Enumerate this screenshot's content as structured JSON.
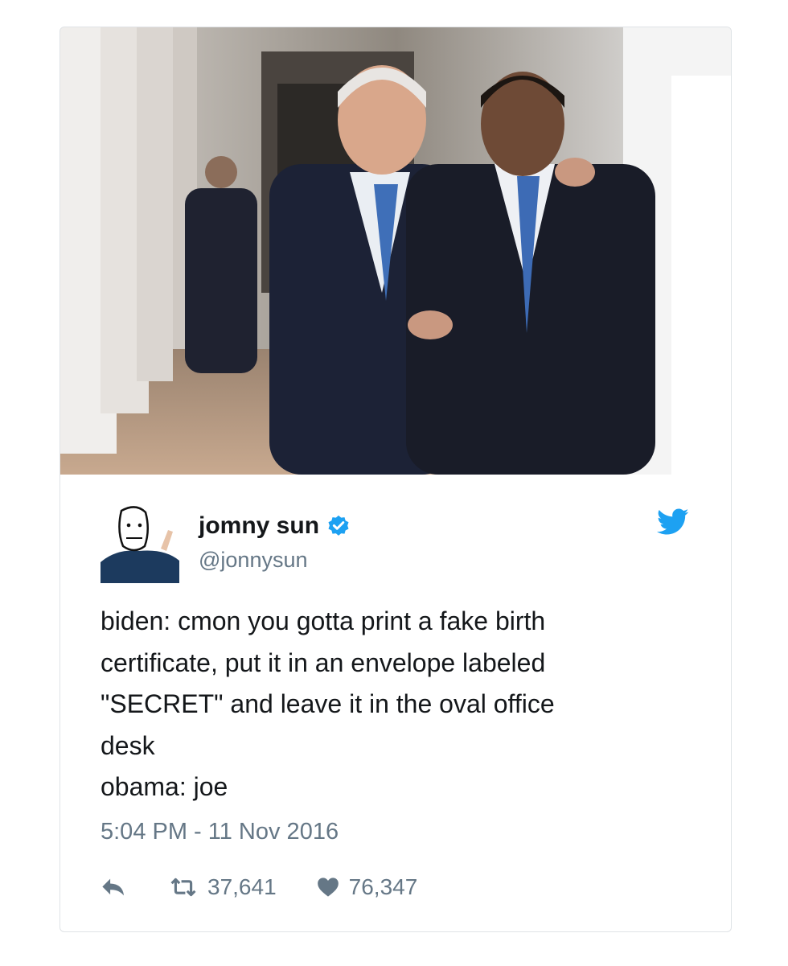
{
  "photo": {
    "alt_icon": "photo-of-two-men-in-suits-icon"
  },
  "author": {
    "display_name": "jomny sun",
    "handle": "@jonnysun",
    "verified": true,
    "avatar_icon": "cartoon-avatar-icon"
  },
  "brand": {
    "icon": "twitter-bird-icon",
    "color": "#1da1f2"
  },
  "tweet": {
    "lines": [
      "biden: cmon you gotta print a fake birth",
      "certificate, put it in an envelope labeled",
      "\"SECRET\" and leave it in the oval office",
      "desk",
      "obama: joe"
    ],
    "timestamp": "5:04 PM - 11 Nov 2016"
  },
  "actions": {
    "reply_icon": "reply-icon",
    "retweet_icon": "retweet-icon",
    "retweet_count": "37,641",
    "like_icon": "heart-icon",
    "like_count": "76,347"
  },
  "colors": {
    "text": "#14171a",
    "secondary": "#657786",
    "verified": "#1da1f2"
  }
}
